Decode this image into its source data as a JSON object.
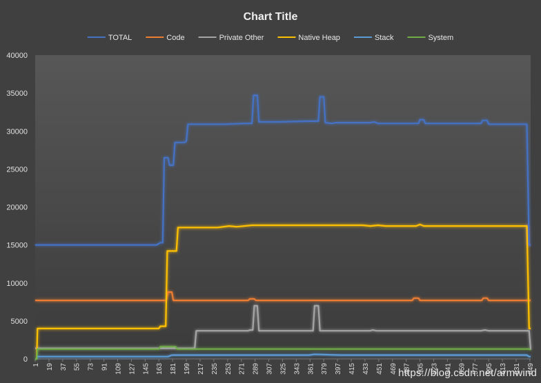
{
  "watermark": "https://blog.csdn.net/armwind",
  "chart_data": {
    "type": "line",
    "title": "Chart Title",
    "xlabel": "",
    "ylabel": "",
    "ylim": [
      0,
      40000
    ],
    "yticks": [
      "0",
      "5000",
      "10000",
      "15000",
      "20000",
      "25000",
      "30000",
      "35000",
      "40000"
    ],
    "xlim": [
      1,
      650
    ],
    "xticks": [
      "1",
      "19",
      "37",
      "55",
      "73",
      "91",
      "109",
      "127",
      "145",
      "163",
      "181",
      "199",
      "217",
      "235",
      "253",
      "271",
      "289",
      "307",
      "325",
      "343",
      "361",
      "379",
      "397",
      "415",
      "433",
      "451",
      "469",
      "487",
      "505",
      "523",
      "541",
      "559",
      "577",
      "595",
      "613",
      "631",
      "649"
    ],
    "legend_position": "top",
    "grid": false,
    "series": [
      {
        "name": "TOTAL",
        "color": "#4472C4",
        "points": [
          [
            1,
            15000
          ],
          [
            160,
            15000
          ],
          [
            165,
            15300
          ],
          [
            168,
            15300
          ],
          [
            170,
            26500
          ],
          [
            175,
            26500
          ],
          [
            177,
            25500
          ],
          [
            182,
            25500
          ],
          [
            184,
            28500
          ],
          [
            197,
            28500
          ],
          [
            199,
            28700
          ],
          [
            201,
            30900
          ],
          [
            250,
            30900
          ],
          [
            275,
            31000
          ],
          [
            285,
            31000
          ],
          [
            287,
            34700
          ],
          [
            292,
            34700
          ],
          [
            294,
            31200
          ],
          [
            320,
            31200
          ],
          [
            360,
            31300
          ],
          [
            372,
            31300
          ],
          [
            374,
            34500
          ],
          [
            379,
            34500
          ],
          [
            381,
            31100
          ],
          [
            390,
            31000
          ],
          [
            395,
            31100
          ],
          [
            440,
            31100
          ],
          [
            445,
            31200
          ],
          [
            450,
            31000
          ],
          [
            503,
            31000
          ],
          [
            505,
            31500
          ],
          [
            510,
            31500
          ],
          [
            512,
            31000
          ],
          [
            585,
            31000
          ],
          [
            587,
            31400
          ],
          [
            593,
            31400
          ],
          [
            595,
            30900
          ],
          [
            645,
            30900
          ],
          [
            648,
            15000
          ],
          [
            650,
            15000
          ]
        ]
      },
      {
        "name": "Code",
        "color": "#ED7D31",
        "points": [
          [
            1,
            7700
          ],
          [
            173,
            7700
          ],
          [
            175,
            8800
          ],
          [
            180,
            8800
          ],
          [
            182,
            7700
          ],
          [
            280,
            7700
          ],
          [
            282,
            7900
          ],
          [
            288,
            7900
          ],
          [
            290,
            7700
          ],
          [
            495,
            7700
          ],
          [
            497,
            8000
          ],
          [
            503,
            8000
          ],
          [
            505,
            7700
          ],
          [
            586,
            7700
          ],
          [
            588,
            8000
          ],
          [
            593,
            8000
          ],
          [
            595,
            7700
          ],
          [
            650,
            7700
          ]
        ]
      },
      {
        "name": "Private Other",
        "color": "#A5A5A5",
        "points": [
          [
            1,
            1400
          ],
          [
            210,
            1400
          ],
          [
            212,
            3700
          ],
          [
            280,
            3700
          ],
          [
            282,
            3800
          ],
          [
            286,
            3800
          ],
          [
            288,
            7000
          ],
          [
            292,
            7000
          ],
          [
            294,
            3700
          ],
          [
            365,
            3700
          ],
          [
            367,
            7000
          ],
          [
            372,
            7000
          ],
          [
            374,
            3700
          ],
          [
            440,
            3700
          ],
          [
            443,
            3800
          ],
          [
            448,
            3700
          ],
          [
            585,
            3700
          ],
          [
            590,
            3800
          ],
          [
            595,
            3700
          ],
          [
            648,
            3700
          ],
          [
            650,
            1200
          ]
        ]
      },
      {
        "name": "Native Heap",
        "color": "#FFC000",
        "points": [
          [
            1,
            0
          ],
          [
            3,
            0
          ],
          [
            4,
            4000
          ],
          [
            163,
            4000
          ],
          [
            165,
            4300
          ],
          [
            172,
            4300
          ],
          [
            174,
            14200
          ],
          [
            186,
            14200
          ],
          [
            188,
            17300
          ],
          [
            240,
            17300
          ],
          [
            255,
            17500
          ],
          [
            265,
            17400
          ],
          [
            285,
            17600
          ],
          [
            370,
            17600
          ],
          [
            430,
            17600
          ],
          [
            440,
            17500
          ],
          [
            450,
            17600
          ],
          [
            460,
            17500
          ],
          [
            500,
            17500
          ],
          [
            505,
            17700
          ],
          [
            510,
            17500
          ],
          [
            645,
            17500
          ],
          [
            648,
            4000
          ],
          [
            650,
            4000
          ]
        ]
      },
      {
        "name": "Stack",
        "color": "#5B9BD5",
        "points": [
          [
            1,
            0
          ],
          [
            3,
            0
          ],
          [
            4,
            300
          ],
          [
            175,
            300
          ],
          [
            180,
            500
          ],
          [
            360,
            500
          ],
          [
            366,
            600
          ],
          [
            400,
            500
          ],
          [
            645,
            500
          ],
          [
            648,
            300
          ],
          [
            650,
            300
          ]
        ]
      },
      {
        "name": "System",
        "color": "#70AD47",
        "points": [
          [
            1,
            0
          ],
          [
            3,
            0
          ],
          [
            4,
            1300
          ],
          [
            163,
            1300
          ],
          [
            165,
            1600
          ],
          [
            185,
            1600
          ],
          [
            187,
            1300
          ],
          [
            645,
            1300
          ],
          [
            648,
            1300
          ],
          [
            650,
            1200
          ]
        ]
      }
    ]
  }
}
